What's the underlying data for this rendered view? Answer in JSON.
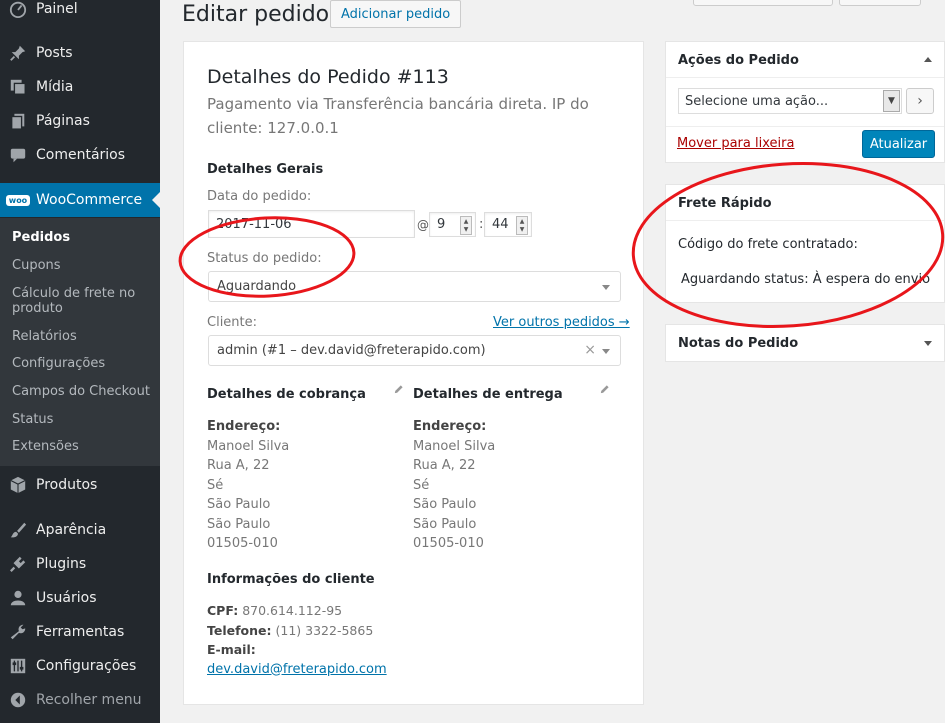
{
  "sidebar": {
    "items": [
      {
        "label": "Painel",
        "icon": "dashboard-icon"
      },
      {
        "label": "Posts",
        "icon": "pin-icon"
      },
      {
        "label": "Mídia",
        "icon": "media-icon"
      },
      {
        "label": "Páginas",
        "icon": "page-icon"
      },
      {
        "label": "Comentários",
        "icon": "comment-icon"
      },
      {
        "label": "WooCommerce",
        "icon": "woo-icon",
        "icon_text": "woo"
      },
      {
        "label": "Produtos",
        "icon": "box-icon"
      },
      {
        "label": "Aparência",
        "icon": "brush-icon"
      },
      {
        "label": "Plugins",
        "icon": "plug-icon"
      },
      {
        "label": "Usuários",
        "icon": "user-icon"
      },
      {
        "label": "Ferramentas",
        "icon": "wrench-icon"
      },
      {
        "label": "Configurações",
        "icon": "settings-icon"
      },
      {
        "label": "Recolher menu",
        "icon": "collapse-icon"
      }
    ],
    "woocommerce_submenu": [
      "Pedidos",
      "Cupons",
      "Cálculo de frete no produto",
      "Relatórios",
      "Configurações",
      "Campos do Checkout",
      "Status",
      "Extensões"
    ],
    "accent_color": "#0073aa"
  },
  "header": {
    "title": "Editar pedido",
    "add_order_label": "Adicionar pedido"
  },
  "order": {
    "title": "Detalhes do Pedido #113",
    "subtitle": "Pagamento via Transferência bancária direta. IP do cliente: 127.0.0.1",
    "general_heading": "Detalhes Gerais",
    "date_label": "Data do pedido:",
    "date_value": "2017-11-06",
    "at_symbol": "@",
    "hour_value": "9",
    "minute_value": "44",
    "time_separator": ":",
    "status_label": "Status do pedido:",
    "status_value": "Aguardando",
    "customer_label": "Cliente:",
    "customer_link": "Ver outros pedidos →",
    "customer_value": "admin (#1 – dev.david@freterapido.com)",
    "clear_symbol": "×",
    "billing": {
      "heading": "Detalhes de cobrança",
      "address_label": "Endereço:",
      "lines": [
        "Manoel Silva",
        "Rua A, 22",
        "Sé",
        "São Paulo",
        "São Paulo",
        "01505-010"
      ]
    },
    "shipping": {
      "heading": "Detalhes de entrega",
      "address_label": "Endereço:",
      "lines": [
        "Manoel Silva",
        "Rua A, 22",
        "Sé",
        "São Paulo",
        "São Paulo",
        "01505-010"
      ]
    },
    "customer_info": {
      "heading": "Informações do cliente",
      "cpf_label": "CPF:",
      "cpf_value": "870.614.112-95",
      "phone_label": "Telefone:",
      "phone_value": "(11) 3322-5865",
      "email_label": "E-mail:",
      "email_value": "dev.david@freterapido.com"
    }
  },
  "actions_box": {
    "title": "Ações do Pedido",
    "select_placeholder": "Selecione uma ação...",
    "go_symbol": "›",
    "trash_label": "Mover para lixeira",
    "update_label": "Atualizar"
  },
  "frete_box": {
    "title": "Frete Rápido",
    "code_label": "Código do frete contratado:",
    "status_label": "Aguardando status:",
    "status_value": "À espera do envio"
  },
  "notes_box": {
    "title": "Notas do Pedido"
  },
  "annotation_color": "#e8161b"
}
